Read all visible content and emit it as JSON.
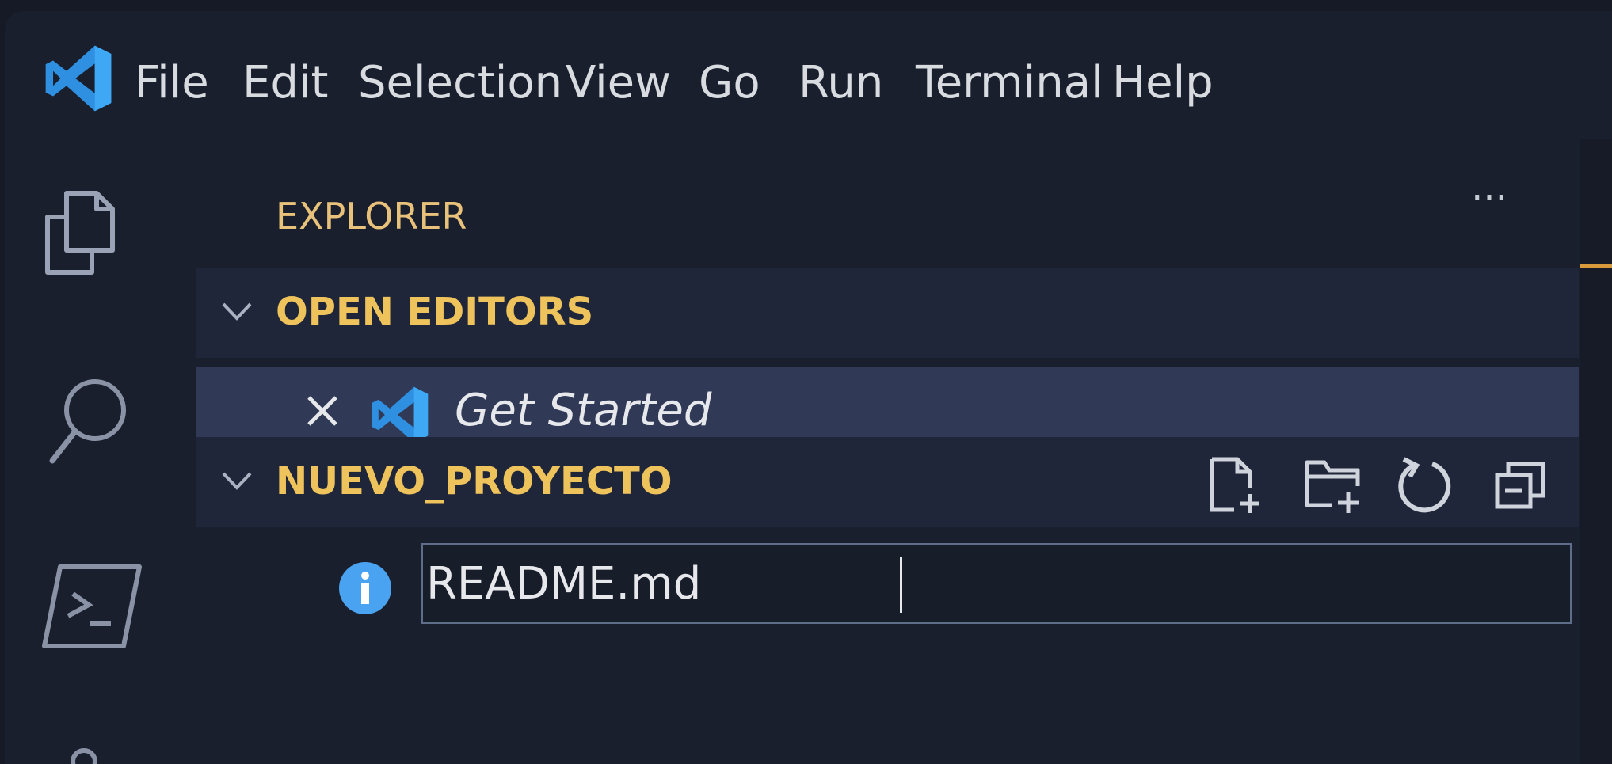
{
  "app": {
    "logo": "vscode-logo-icon"
  },
  "menubar": {
    "items": [
      "File",
      "Edit",
      "Selection",
      "View",
      "Go",
      "Run",
      "Terminal",
      "Help"
    ]
  },
  "activity_bar": {
    "icons": [
      "explorer-icon",
      "search-icon",
      "terminal-icon",
      "account-icon"
    ]
  },
  "sidebar": {
    "title": "EXPLORER",
    "more_actions": "···",
    "open_editors": {
      "label": "OPEN EDITORS",
      "items": [
        {
          "label": "Get Started",
          "icon": "vscode-logo-icon",
          "close_icon": "close-icon"
        }
      ]
    },
    "project": {
      "label": "NUEVO_PROYECTO",
      "actions": [
        "new-file-icon",
        "new-folder-icon",
        "refresh-icon",
        "collapse-all-icon"
      ],
      "rename_value": "README.md",
      "file_icon": "info-icon"
    }
  },
  "colors": {
    "background": "#1a1f2d",
    "section_header": "#20263a",
    "selected_row": "#303a57",
    "accent_yellow": "#efc35b",
    "title_yellow": "#e8c27a",
    "vscode_blue": "#3e9be8",
    "info_blue": "#4aa3f0"
  }
}
